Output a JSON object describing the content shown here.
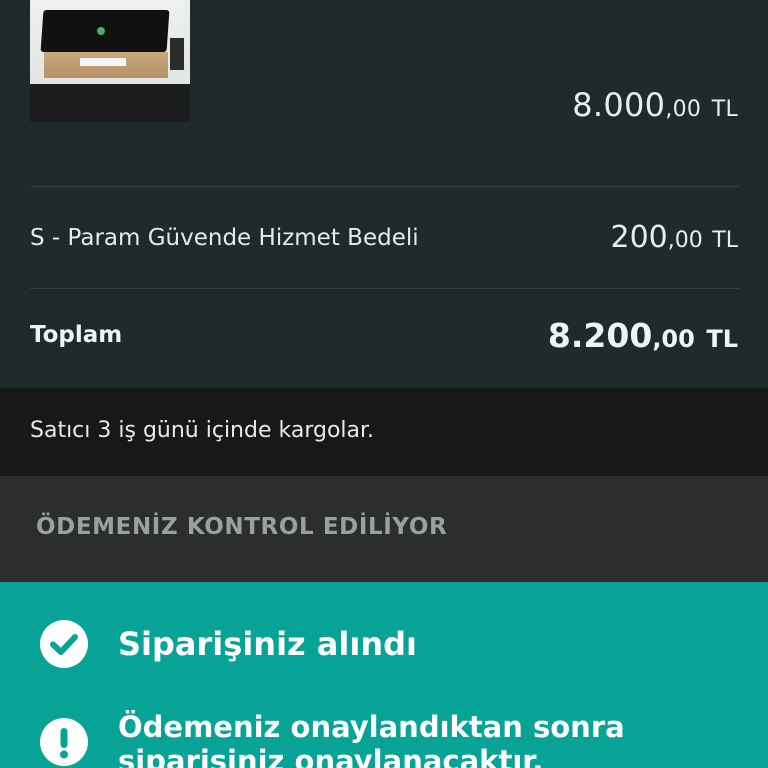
{
  "order_summary": {
    "product": {
      "image_alt": "printer-product-photo",
      "price_main": "8.000",
      "price_decimals": ",00",
      "currency": "TL"
    },
    "service_fee": {
      "label": "S - Param Güvende Hizmet Bedeli",
      "amount_main": "200",
      "amount_decimals": ",00",
      "currency": "TL"
    },
    "total": {
      "label": "Toplam",
      "amount_main": "8.200",
      "amount_decimals": ",00",
      "currency": "TL"
    }
  },
  "shipping_info": {
    "text": "Satıcı 3 iş günü içinde kargolar."
  },
  "payment_status": {
    "text": "ÖDEMENİZ KONTROL EDİLİYOR"
  },
  "status_panel": {
    "accent_color": "#07a396",
    "items": [
      {
        "icon": "check-circle-icon",
        "text": "Siparişiniz alındı"
      },
      {
        "icon": "exclamation-circle-icon",
        "text_line1": "Ödemeniz onaylandıktan sonra",
        "text_line2": "siparişiniz onaylanacaktır."
      }
    ]
  }
}
